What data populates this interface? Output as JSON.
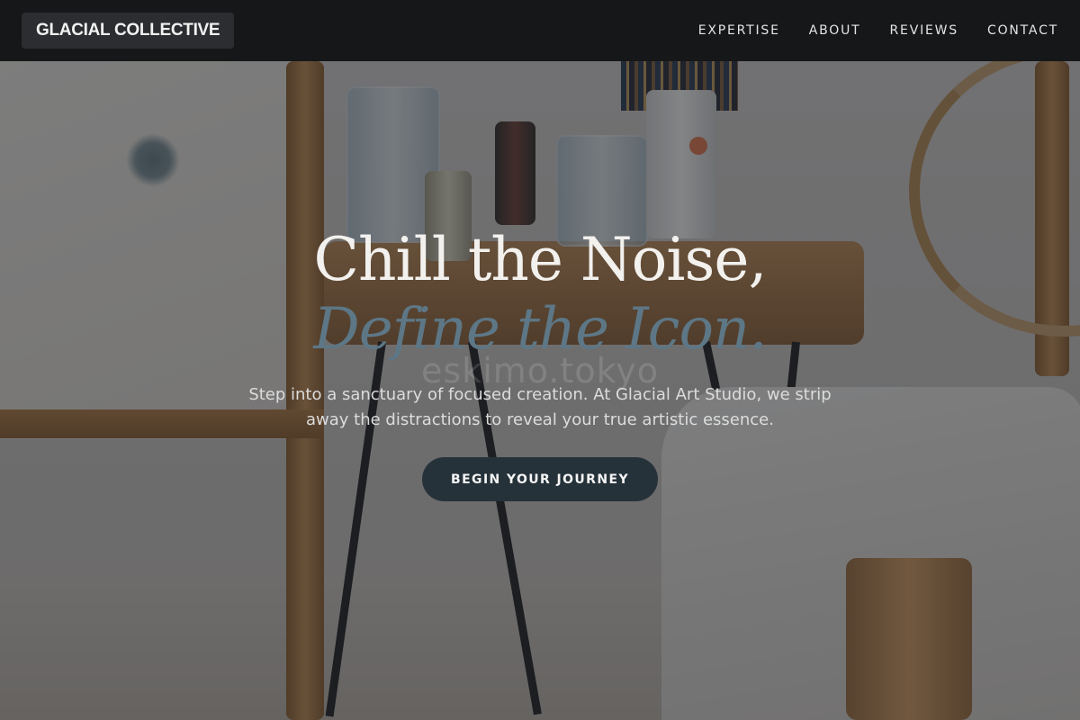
{
  "header": {
    "brand": "GLACIAL COLLECTIVE",
    "nav": [
      {
        "label": "EXPERTISE"
      },
      {
        "label": "ABOUT"
      },
      {
        "label": "REVIEWS"
      },
      {
        "label": "CONTACT"
      }
    ]
  },
  "hero": {
    "title_line1": "Chill the Noise,",
    "title_line2": "Define the Icon.",
    "watermark": "eskimo.tokyo",
    "subtitle": "Step into a sanctuary of focused creation. At Glacial Art Studio, we strip away the distractions to reveal your true artistic essence.",
    "cta_label": "BEGIN YOUR JOURNEY"
  },
  "colors": {
    "header_bg": "#161719",
    "brand_bg": "#2c2d30",
    "accent_italic": "#5d7786",
    "cta_bg": "#26323a"
  }
}
